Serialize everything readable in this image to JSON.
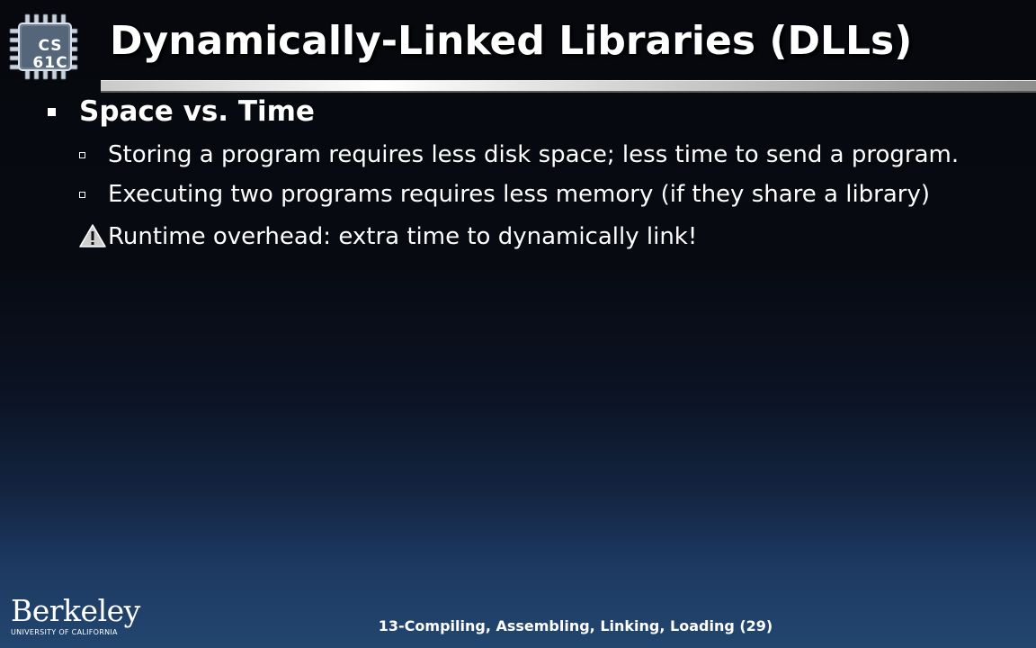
{
  "logo": {
    "line1": "CS",
    "line2": "61C",
    "icon": "chip-icon"
  },
  "slide": {
    "title": "Dynamically-Linked Libraries (DLLs)",
    "bullet": {
      "heading": "Space vs. Time",
      "subpoints": [
        "Storing a program requires less disk space; less time to send a program.",
        "Executing two programs requires less memory (if they share a library)"
      ],
      "warning": {
        "icon": "warning-icon",
        "text": "Runtime overhead: extra time to dynamically link!"
      }
    }
  },
  "footer": {
    "lecture": "13-Compiling, Assembling, Linking, Loading (29)",
    "institution": "Berkeley",
    "institution_sub": "UNIVERSITY OF CALIFORNIA"
  },
  "colors": {
    "text": "#ffffff",
    "background_top": "#06080d",
    "background_bottom": "#22466f",
    "logo_chip": "#c9d2dc"
  }
}
